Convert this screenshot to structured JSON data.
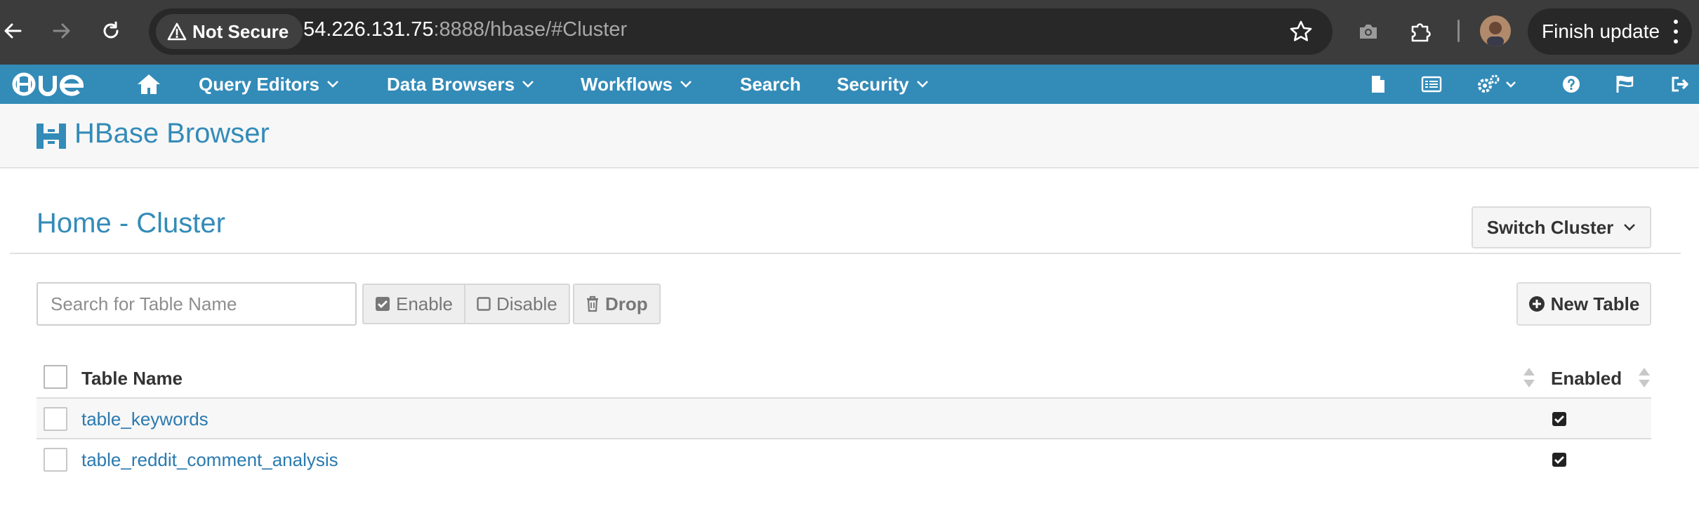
{
  "browser": {
    "security_label": "Not Secure",
    "url_host": "54.226.131.75",
    "url_rest": ":8888/hbase/#Cluster",
    "update_label": "Finish update"
  },
  "hue_nav": {
    "items": [
      {
        "label": "Query Editors",
        "dropdown": true
      },
      {
        "label": "Data Browsers",
        "dropdown": true
      },
      {
        "label": "Workflows",
        "dropdown": true
      },
      {
        "label": "Search",
        "dropdown": false
      },
      {
        "label": "Security",
        "dropdown": true
      }
    ],
    "right_icons": [
      "document-icon",
      "jobs-list-icon",
      "settings-cogs-icon",
      "help-icon",
      "tour-flag-icon",
      "logout-icon"
    ],
    "color": "#338bb8"
  },
  "app": {
    "title": "HBase Browser"
  },
  "page": {
    "title_home": "Home",
    "title_sep": "-",
    "title_cluster": "Cluster",
    "switch_cluster_label": "Switch Cluster"
  },
  "toolbar": {
    "search_placeholder": "Search for Table Name",
    "enable_label": "Enable",
    "disable_label": "Disable",
    "drop_label": "Drop",
    "new_table_label": "New Table"
  },
  "table": {
    "columns": [
      "Table Name",
      "Enabled"
    ],
    "rows": [
      {
        "name": "table_keywords",
        "enabled": true
      },
      {
        "name": "table_reddit_comment_analysis",
        "enabled": true
      }
    ]
  }
}
